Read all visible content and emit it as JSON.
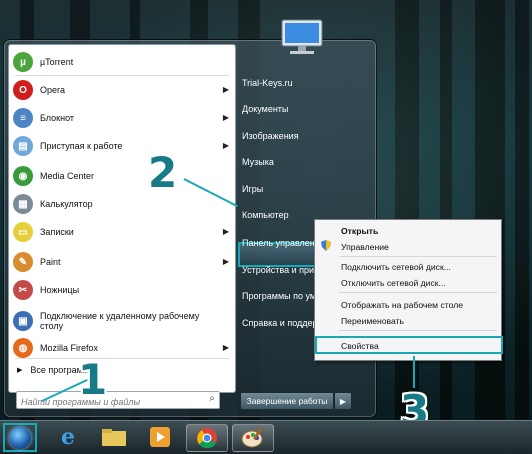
{
  "start_menu": {
    "programs": [
      {
        "label": "µTorrent",
        "icon": "utorrent-icon",
        "color": "#4aa63c",
        "glyph": "µ",
        "arrow": false
      },
      {
        "label": "Opera",
        "icon": "opera-icon",
        "color": "#d01e1e",
        "glyph": "O",
        "arrow": true
      },
      {
        "label": "Блокнот",
        "icon": "notepad-icon",
        "color": "#4c84c4",
        "glyph": "≡",
        "arrow": true
      },
      {
        "label": "Приступая к работе",
        "icon": "getting-started-icon",
        "color": "#6fa7d8",
        "glyph": "▤",
        "arrow": true
      },
      {
        "label": "Media Center",
        "icon": "media-center-icon",
        "color": "#3a9a3a",
        "glyph": "◉",
        "arrow": false
      },
      {
        "label": "Калькулятор",
        "icon": "calculator-icon",
        "color": "#7a8c9a",
        "glyph": "▦",
        "arrow": false
      },
      {
        "label": "Записки",
        "icon": "sticky-notes-icon",
        "color": "#e5cf3b",
        "glyph": "▭",
        "arrow": true
      },
      {
        "label": "Paint",
        "icon": "paint-icon",
        "color": "#d98c2e",
        "glyph": "✎",
        "arrow": true
      },
      {
        "label": "Ножницы",
        "icon": "scissors-icon",
        "color": "#c74a4a",
        "glyph": "✂",
        "arrow": false
      },
      {
        "label": "Подключение к удаленному рабочему столу",
        "icon": "remote-desktop-icon",
        "color": "#3a6fb5",
        "glyph": "▣",
        "arrow": false
      },
      {
        "label": "Mozilla Firefox",
        "icon": "firefox-icon",
        "color": "#e56a1c",
        "glyph": "◍",
        "arrow": true
      }
    ],
    "all_programs": "Все программы",
    "search_placeholder": "Найти программы и файлы",
    "right_items": [
      "Trial-Keys.ru",
      "Документы",
      "Изображения",
      "Музыка",
      "Игры",
      "Компьютер",
      "Панель управления",
      "Устройства и принтеры",
      "Программы по умолчанию",
      "Справка и поддержка"
    ],
    "shutdown_label": "Завершение работы"
  },
  "context_menu": {
    "items": [
      "Открыть",
      "Управление",
      "Подключить сетевой диск...",
      "Отключить сетевой диск...",
      "Отображать на рабочем столе",
      "Переименовать",
      "Свойства"
    ]
  },
  "callouts": [
    "1",
    "2",
    "3"
  ],
  "accent_color": "#18a9b7"
}
